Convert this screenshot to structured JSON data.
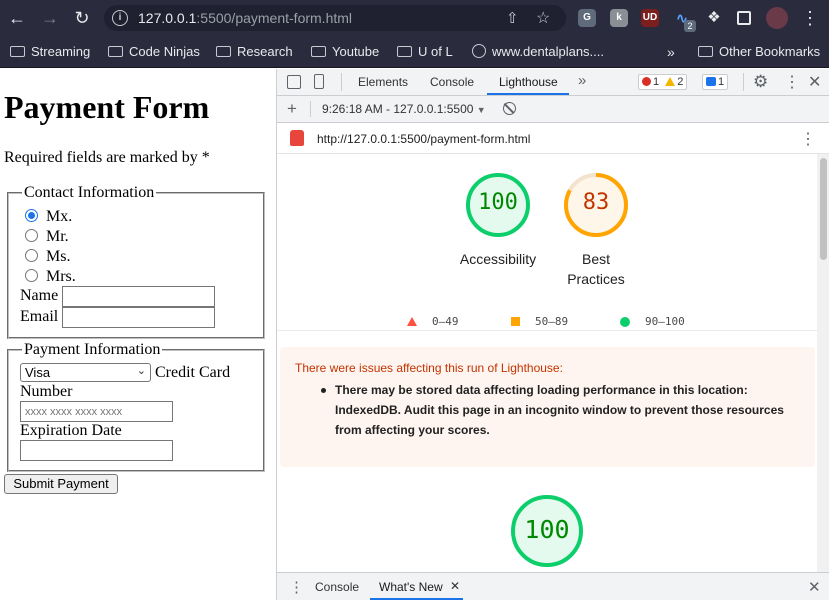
{
  "browser": {
    "url_host": "127.0.0.1",
    "url_rest": ":5500/payment-form.html",
    "bookmarks": [
      "Streaming",
      "Code Ninjas",
      "Research",
      "Youtube",
      "U of L",
      "www.dentalplans....",
      "Other Bookmarks"
    ],
    "extensions_badge": "2"
  },
  "page": {
    "title": "Payment Form",
    "required_note": "Required fields are marked by *",
    "contact": {
      "legend": "Contact Information",
      "titles": [
        "Mx.",
        "Mr.",
        "Ms.",
        "Mrs."
      ],
      "selected_title": "Mx.",
      "name_label": "Name",
      "name_value": "",
      "email_label": "Email",
      "email_value": ""
    },
    "payment": {
      "legend": "Payment Information",
      "card_type_value": "Visa",
      "card_number_label_1": "Credit Card",
      "card_number_label_2": "Number",
      "card_number_placeholder": "xxxx xxxx xxxx xxxx",
      "expiration_label": "Expiration Date",
      "expiration_value": ""
    },
    "submit_label": "Submit Payment"
  },
  "devtools": {
    "tabs": [
      "Elements",
      "Console",
      "Lighthouse"
    ],
    "active_tab": "Lighthouse",
    "more_tabs": "»",
    "errors": "1",
    "warnings": "2",
    "messages": "1",
    "add_label": "+",
    "run_label": "9:26:18 AM - 127.0.0.1:5500",
    "report_url": "http://127.0.0.1:5500/payment-form.html",
    "scores": [
      {
        "value": "100",
        "label_1": "Accessibility",
        "label_2": ""
      },
      {
        "value": "83",
        "label_1": "Best",
        "label_2": "Practices"
      }
    ],
    "bottom_score": "100",
    "legend": [
      "0–49",
      "50–89",
      "90–100"
    ],
    "warning_title": "There were issues affecting this run of Lighthouse:",
    "warning_lines": [
      "There may be stored data affecting loading performance in this location:",
      "IndexedDB. Audit this page in an incognito window to prevent those resources",
      "from affecting your scores."
    ],
    "drawer_tabs": [
      "Console",
      "What's New"
    ],
    "colors": {
      "pass": "#0cce6b",
      "average": "#ffa400",
      "fail": "#ff4e42",
      "accent": "#1a73e8"
    }
  }
}
